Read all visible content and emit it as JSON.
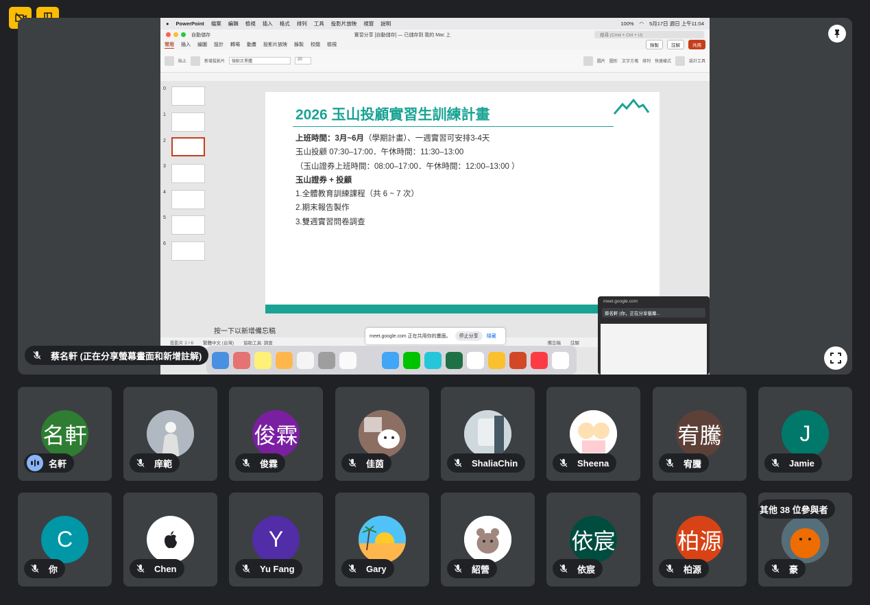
{
  "meet": {
    "top_buttons": {
      "camera_off": "camera-off-icon",
      "exit_room": "door-icon"
    },
    "presenter_label": "蔡名軒 (正在分享螢幕畫面和新增註解)",
    "others_label": "其他 38 位參與者",
    "accent_color": "#fbbc04",
    "participants_row1": [
      {
        "name": "名軒",
        "initials": "名軒",
        "bg": "#2e7d32",
        "speaking": true
      },
      {
        "name": "庠範",
        "initials": "",
        "bg": "#9aa0a6",
        "photo": "person-photo"
      },
      {
        "name": "俊霖",
        "initials": "俊霖",
        "bg": "#7b1fa2"
      },
      {
        "name": "佳茵",
        "initials": "",
        "bg": "#d7ccc8",
        "photo": "cartoon-dog"
      },
      {
        "name": "ShaliaChin",
        "initials": "",
        "bg": "#b0bec5",
        "photo": "photo"
      },
      {
        "name": "Sheena",
        "initials": "",
        "bg": "#fce4ec",
        "photo": "cartoon-pair"
      },
      {
        "name": "宥騰",
        "initials": "宥騰",
        "bg": "#5d4037"
      },
      {
        "name": "Jamie",
        "initials": "J",
        "bg": "#00796b"
      }
    ],
    "participants_row2": [
      {
        "name": "你",
        "initials": "C",
        "bg": "#0097a7"
      },
      {
        "name": "Chen",
        "initials": "",
        "bg": "#ffffff",
        "photo": "apple-logo"
      },
      {
        "name": "Yu Fang",
        "initials": "Y",
        "bg": "#512da8"
      },
      {
        "name": "Gary",
        "initials": "",
        "bg": "#ffb74d",
        "photo": "beach-sunset"
      },
      {
        "name": "紹營",
        "initials": "",
        "bg": "#ffffff",
        "photo": "bear-sticker"
      },
      {
        "name": "依宸",
        "initials": "依宸",
        "bg": "#004d40"
      },
      {
        "name": "柏源",
        "initials": "柏源",
        "bg": "#d84315"
      },
      {
        "name": "豪",
        "initials": "",
        "bg": "#ef6c00",
        "photo": "dog-photo"
      }
    ]
  },
  "mac": {
    "menubar": {
      "app": "PowerPoint",
      "menus": [
        "檔案",
        "編輯",
        "檢視",
        "插入",
        "格式",
        "排列",
        "工具",
        "投影片放映",
        "視窗",
        "說明"
      ],
      "battery": "100%",
      "clock": "5月17日 週日 上午11:04"
    },
    "window": {
      "autosave": "自動儲存",
      "title": "實習分享 [自動儲存] — 已儲存到 我的 Mac 上",
      "search_placeholder": "搜尋 (Cmd + Ctrl + U)"
    },
    "ribbon_tabs": [
      "常用",
      "插入",
      "繪圖",
      "設計",
      "轉場",
      "動畫",
      "投影片放映",
      "錄製",
      "校閱",
      "檢視"
    ],
    "ribbon_right": {
      "record": "錄製",
      "comments": "註解",
      "share": "共用"
    },
    "ribbon": {
      "paste": "貼上",
      "new_slide": "新增投影片",
      "font": "微軟正黑體",
      "size": "20",
      "picture": "圖片",
      "shape": "圖形",
      "textbox": "文字方塊",
      "arrange": "排列",
      "quick_styles": "快速樣式",
      "design": "設計工具"
    },
    "thumb_numbers": [
      "0",
      "1",
      "2",
      "3",
      "4",
      "5",
      "6"
    ],
    "slide": {
      "title": "2026 玉山投顧實習生訓練計畫",
      "lines": [
        {
          "bold": "上班時間：3月~6月",
          "text": "（學期計畫）、一週實習可安排3-4天"
        },
        {
          "bold": "",
          "text": "玉山投顧 07:30–17:00．午休時間：11:30–13:00"
        },
        {
          "bold": "",
          "text": "（玉山證券上班時間：08:00–17:00．午休時間：12:00–13:00 ）"
        },
        {
          "bold": "玉山證券 + 投顧",
          "text": ""
        },
        {
          "bold": "",
          "text": "1.全體教育訓練課程（共 6 ~ 7 次）"
        },
        {
          "bold": "",
          "text": "2.期末報告製作"
        },
        {
          "bold": "",
          "text": "3.雙週實習問卷調查"
        }
      ]
    },
    "notes_placeholder": "按一下以新增備忘稿",
    "status": {
      "slide_count": "投影片 2 / 6",
      "language": "繁體中文 (台灣)",
      "accessibility": "協助工具: 調查",
      "notes": "備忘稿",
      "comments": "註解"
    },
    "share_bar": {
      "text": "meet.google.com 正在共用你的畫面。",
      "stop": "停止分享",
      "hide": "隱藏"
    },
    "pip": {
      "url": "meet.google.com",
      "chip": "蔡名軒 (你，正在分享螢幕..."
    }
  }
}
